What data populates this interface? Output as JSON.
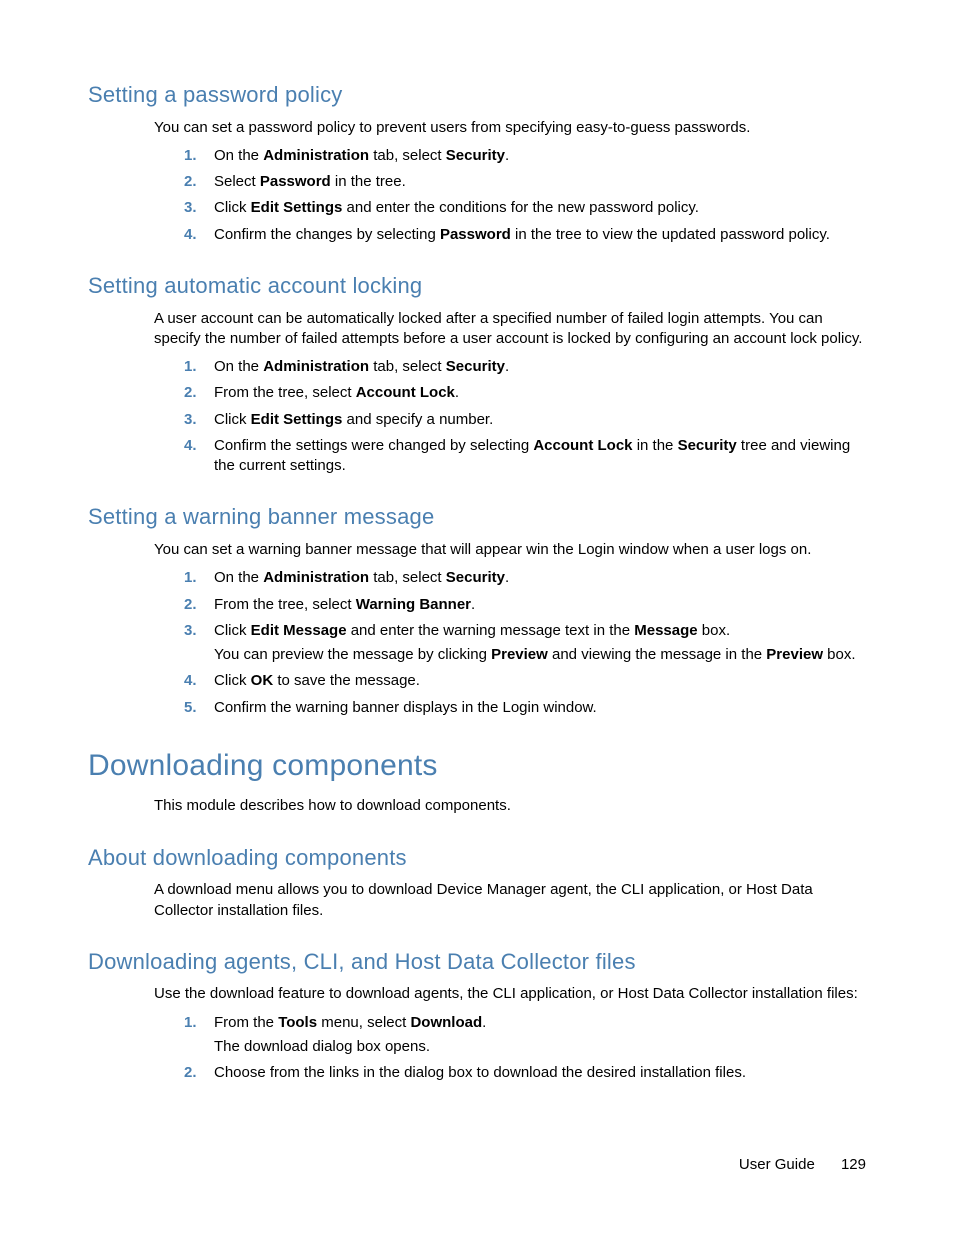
{
  "sections": {
    "password": {
      "heading": "Setting a password policy",
      "intro": "You can set a password policy to prevent users from specifying easy-to-guess passwords.",
      "steps": [
        {
          "pre": "On the ",
          "b1": "Administration",
          "mid1": " tab, select ",
          "b2": "Security",
          "post": "."
        },
        {
          "pre": "Select ",
          "b1": "Password",
          "post": " in the tree."
        },
        {
          "pre": "Click ",
          "b1": "Edit Settings",
          "post": " and enter the conditions for the new password policy."
        },
        {
          "pre": "Confirm the changes by selecting ",
          "b1": "Password",
          "post": " in the tree to view the updated password policy."
        }
      ]
    },
    "locking": {
      "heading": "Setting automatic account locking",
      "intro": "A user account can be automatically locked after a specified number of failed login attempts. You can specify the number of failed attempts before a user account is locked by configuring an account lock policy.",
      "steps": [
        {
          "pre": "On the ",
          "b1": "Administration",
          "mid1": " tab, select ",
          "b2": "Security",
          "post": "."
        },
        {
          "pre": "From the tree, select ",
          "b1": "Account Lock",
          "post": "."
        },
        {
          "pre": "Click ",
          "b1": "Edit Settings",
          "post": " and specify a number."
        },
        {
          "pre": "Confirm the settings were changed by selecting ",
          "b1": "Account Lock",
          "mid1": " in the ",
          "b2": "Security",
          "post": " tree and viewing the current settings."
        }
      ]
    },
    "banner": {
      "heading": "Setting a warning banner message",
      "intro": "You can set a warning banner message that will appear win the Login window when a user logs on.",
      "steps": [
        {
          "pre": "On the ",
          "b1": "Administration",
          "mid1": " tab, select ",
          "b2": "Security",
          "post": "."
        },
        {
          "pre": "From the tree, select ",
          "b1": "Warning Banner",
          "post": "."
        },
        {
          "pre": "Click ",
          "b1": "Edit Message",
          "mid1": " and enter the warning message text in the ",
          "b2": "Message",
          "post": " box.",
          "sub_pre": "You can preview the message by clicking ",
          "sub_b1": "Preview",
          "sub_mid1": " and viewing the message in the ",
          "sub_b2": "Preview",
          "sub_post": " box."
        },
        {
          "pre": "Click ",
          "b1": "OK",
          "post": " to save the message."
        },
        {
          "pre": "Confirm the warning banner displays in the Login window."
        }
      ]
    },
    "downloading": {
      "heading": "Downloading components",
      "intro": "This module describes how to download components."
    },
    "about": {
      "heading": "About downloading components",
      "intro": "A download menu allows you to download Device Manager agent, the CLI application, or Host Data Collector installation files."
    },
    "agents": {
      "heading": "Downloading agents, CLI, and Host Data Collector files",
      "intro": "Use the download feature to download agents, the CLI application, or Host Data Collector installation files:",
      "steps": [
        {
          "pre": "From the ",
          "b1": "Tools",
          "mid1": " menu, select ",
          "b2": "Download",
          "post": ".",
          "sub_pre": "The download dialog box opens."
        },
        {
          "pre": "Choose from the links in the dialog box to download the desired installation files."
        }
      ]
    }
  },
  "footer": {
    "label": "User Guide",
    "page": "129"
  }
}
